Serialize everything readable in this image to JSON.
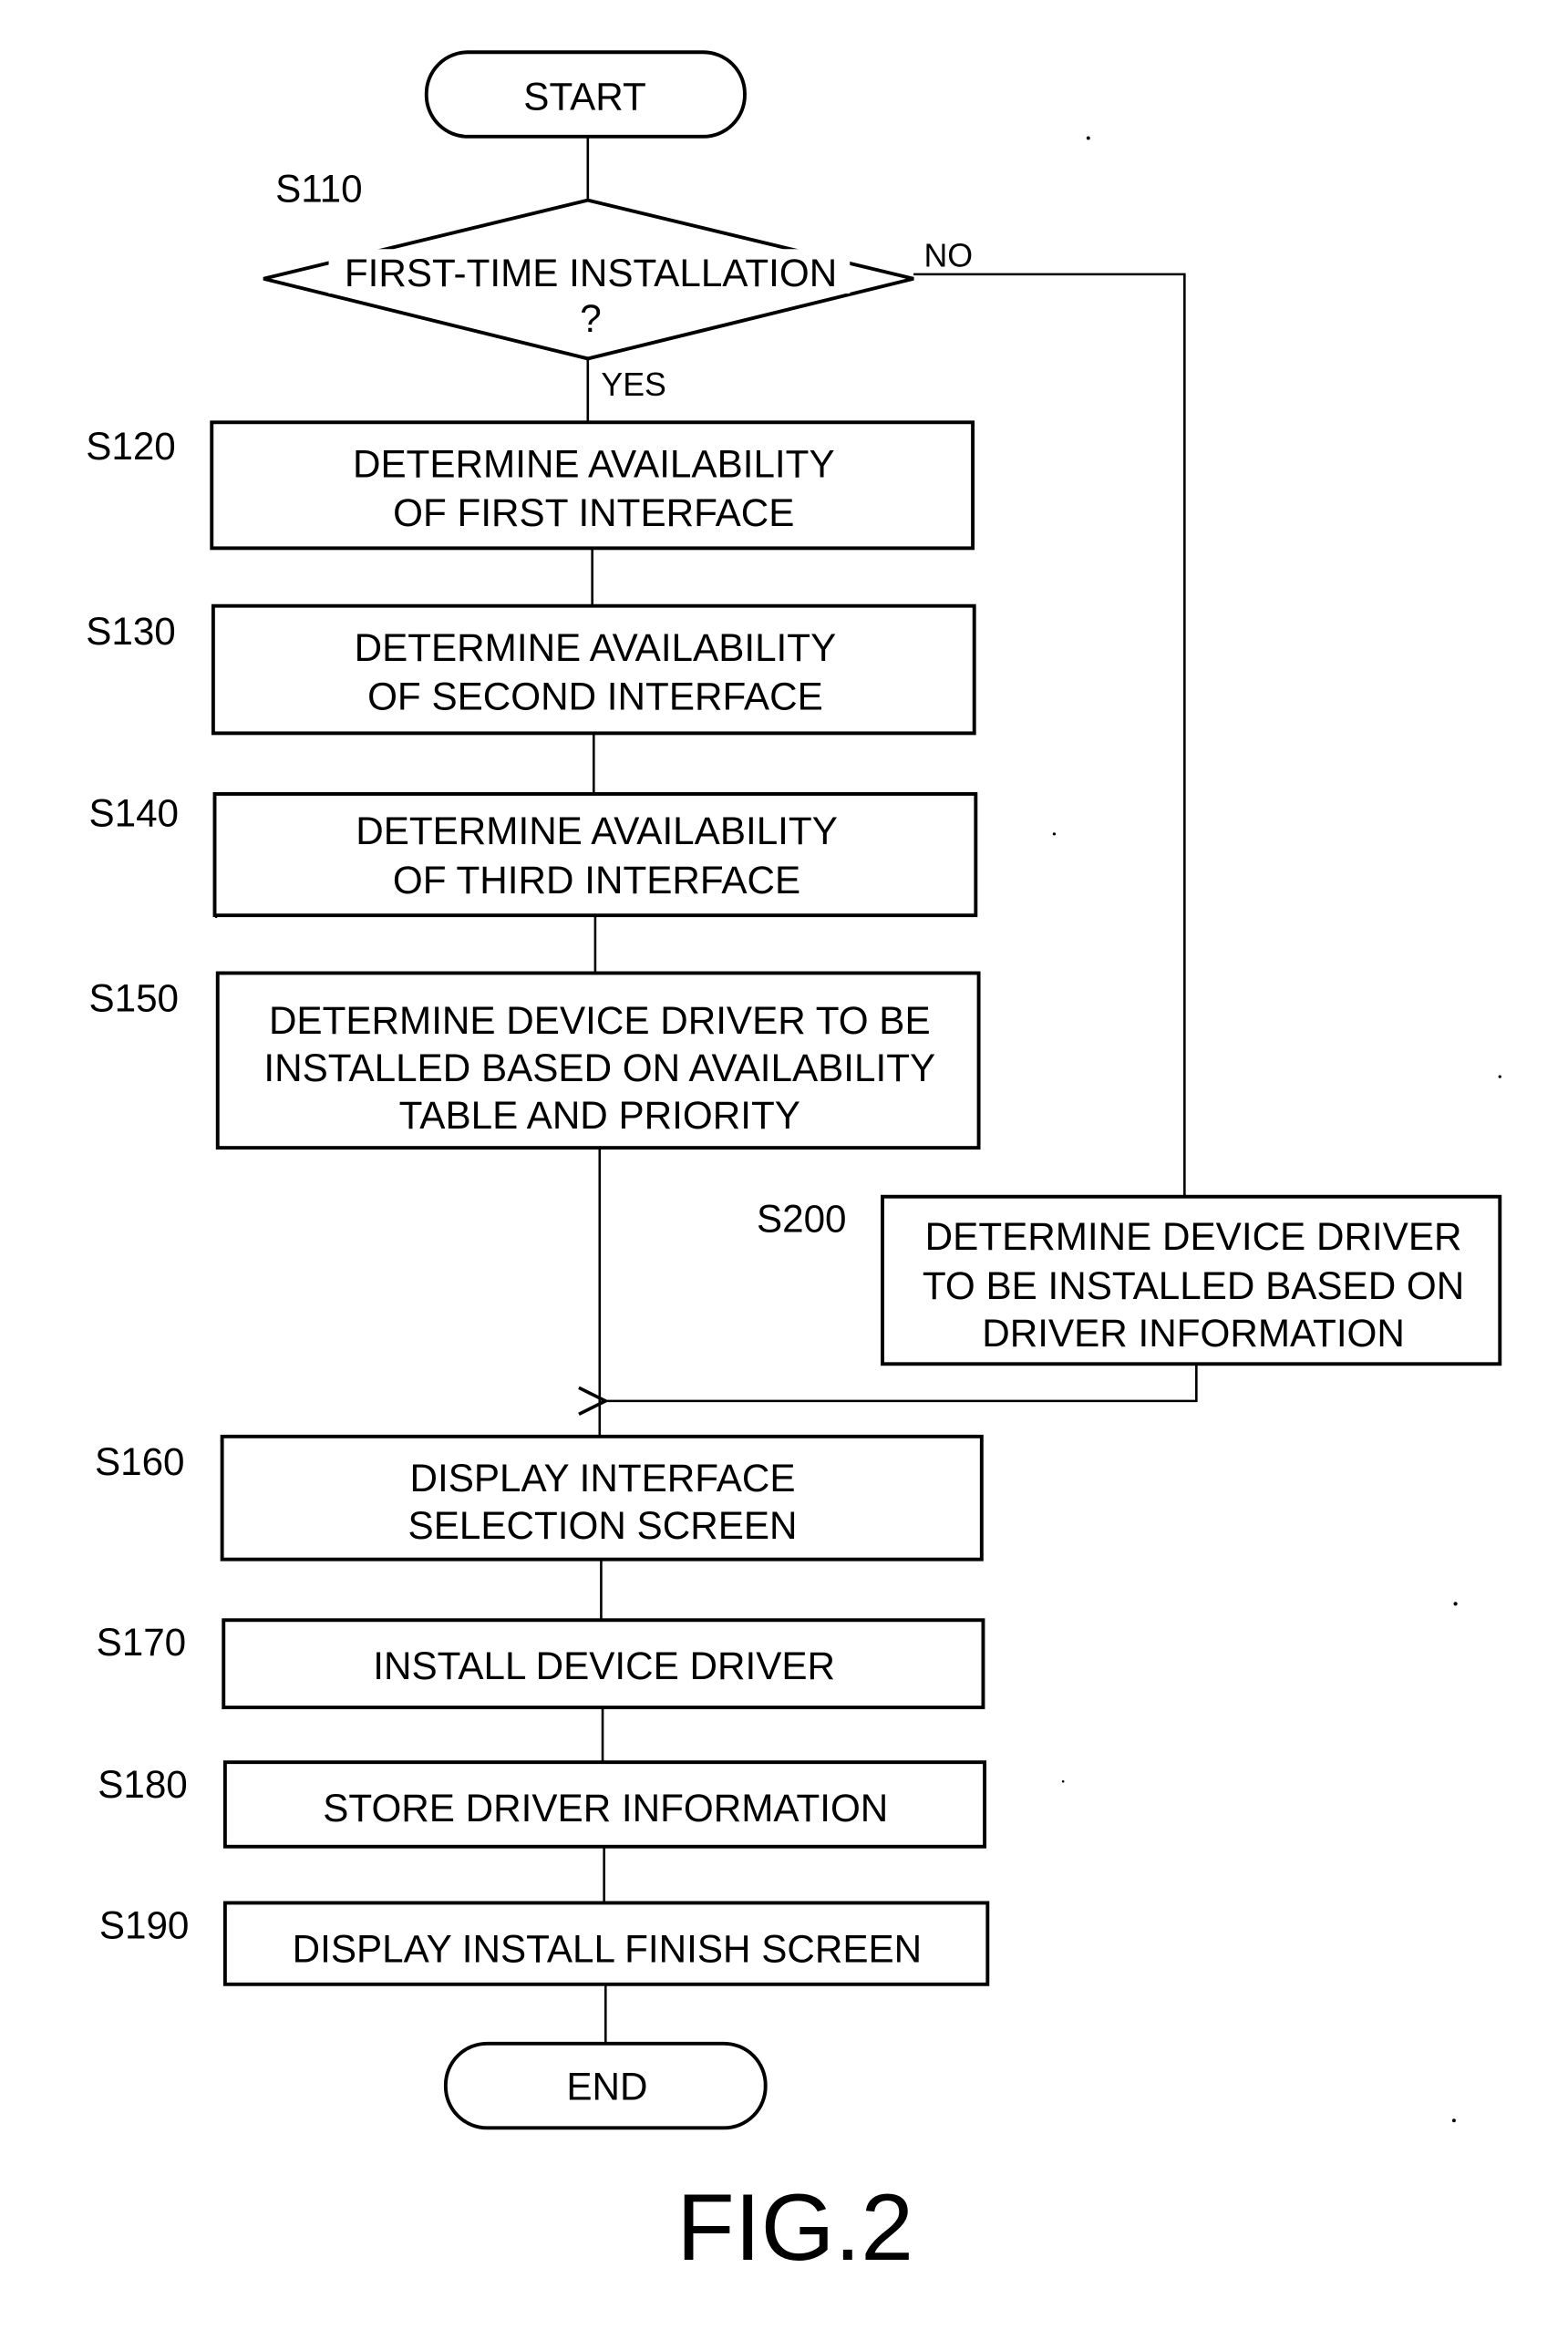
{
  "figure_label": "FIG.2",
  "terminals": {
    "start": "START",
    "end": "END"
  },
  "decision": {
    "step": "S110",
    "lines": [
      "FIRST-TIME INSTALLATION",
      "?"
    ],
    "yes_label": "YES",
    "no_label": "NO"
  },
  "steps": {
    "s120": {
      "id": "S120",
      "lines": [
        "DETERMINE AVAILABILITY",
        "OF FIRST INTERFACE"
      ]
    },
    "s130": {
      "id": "S130",
      "lines": [
        "DETERMINE AVAILABILITY",
        "OF SECOND INTERFACE"
      ]
    },
    "s140": {
      "id": "S140",
      "lines": [
        "DETERMINE AVAILABILITY",
        "OF THIRD INTERFACE"
      ]
    },
    "s150": {
      "id": "S150",
      "lines": [
        "DETERMINE DEVICE DRIVER TO BE",
        "INSTALLED BASED ON AVAILABILITY",
        "TABLE AND PRIORITY"
      ]
    },
    "s200": {
      "id": "S200",
      "lines": [
        "DETERMINE DEVICE DRIVER",
        "TO BE INSTALLED BASED ON",
        "DRIVER INFORMATION"
      ]
    },
    "s160": {
      "id": "S160",
      "lines": [
        "DISPLAY INTERFACE",
        "SELECTION SCREEN"
      ]
    },
    "s170": {
      "id": "S170",
      "lines": [
        "INSTALL DEVICE DRIVER"
      ]
    },
    "s180": {
      "id": "S180",
      "lines": [
        "STORE DRIVER INFORMATION"
      ]
    },
    "s190": {
      "id": "S190",
      "lines": [
        "DISPLAY INSTALL FINISH SCREEN"
      ]
    }
  }
}
